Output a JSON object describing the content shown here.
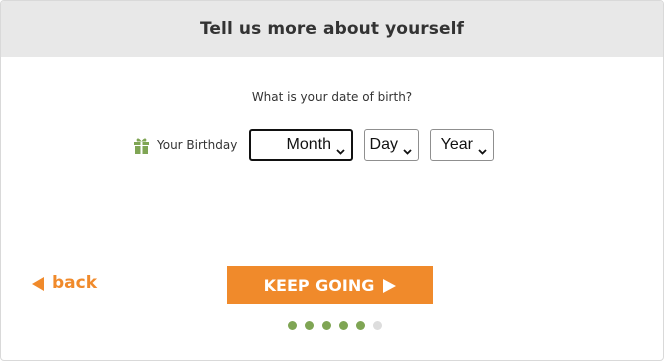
{
  "header": {
    "title": "Tell us more about yourself"
  },
  "question": "What is your date of birth?",
  "birthday_field": {
    "label": "Your Birthday",
    "icon": "gift-icon",
    "month": {
      "selected": "Month"
    },
    "day": {
      "selected": "Day"
    },
    "year": {
      "selected": "Year"
    }
  },
  "nav": {
    "back_label": "back",
    "continue_label": "KEEP GOING"
  },
  "progress": {
    "total_steps": 6,
    "completed_steps": 5
  },
  "colors": {
    "accent": "#f08a2b",
    "progress_done": "#7fa554",
    "progress_todo": "#dddddd",
    "header_bg": "#e8e8e8"
  }
}
